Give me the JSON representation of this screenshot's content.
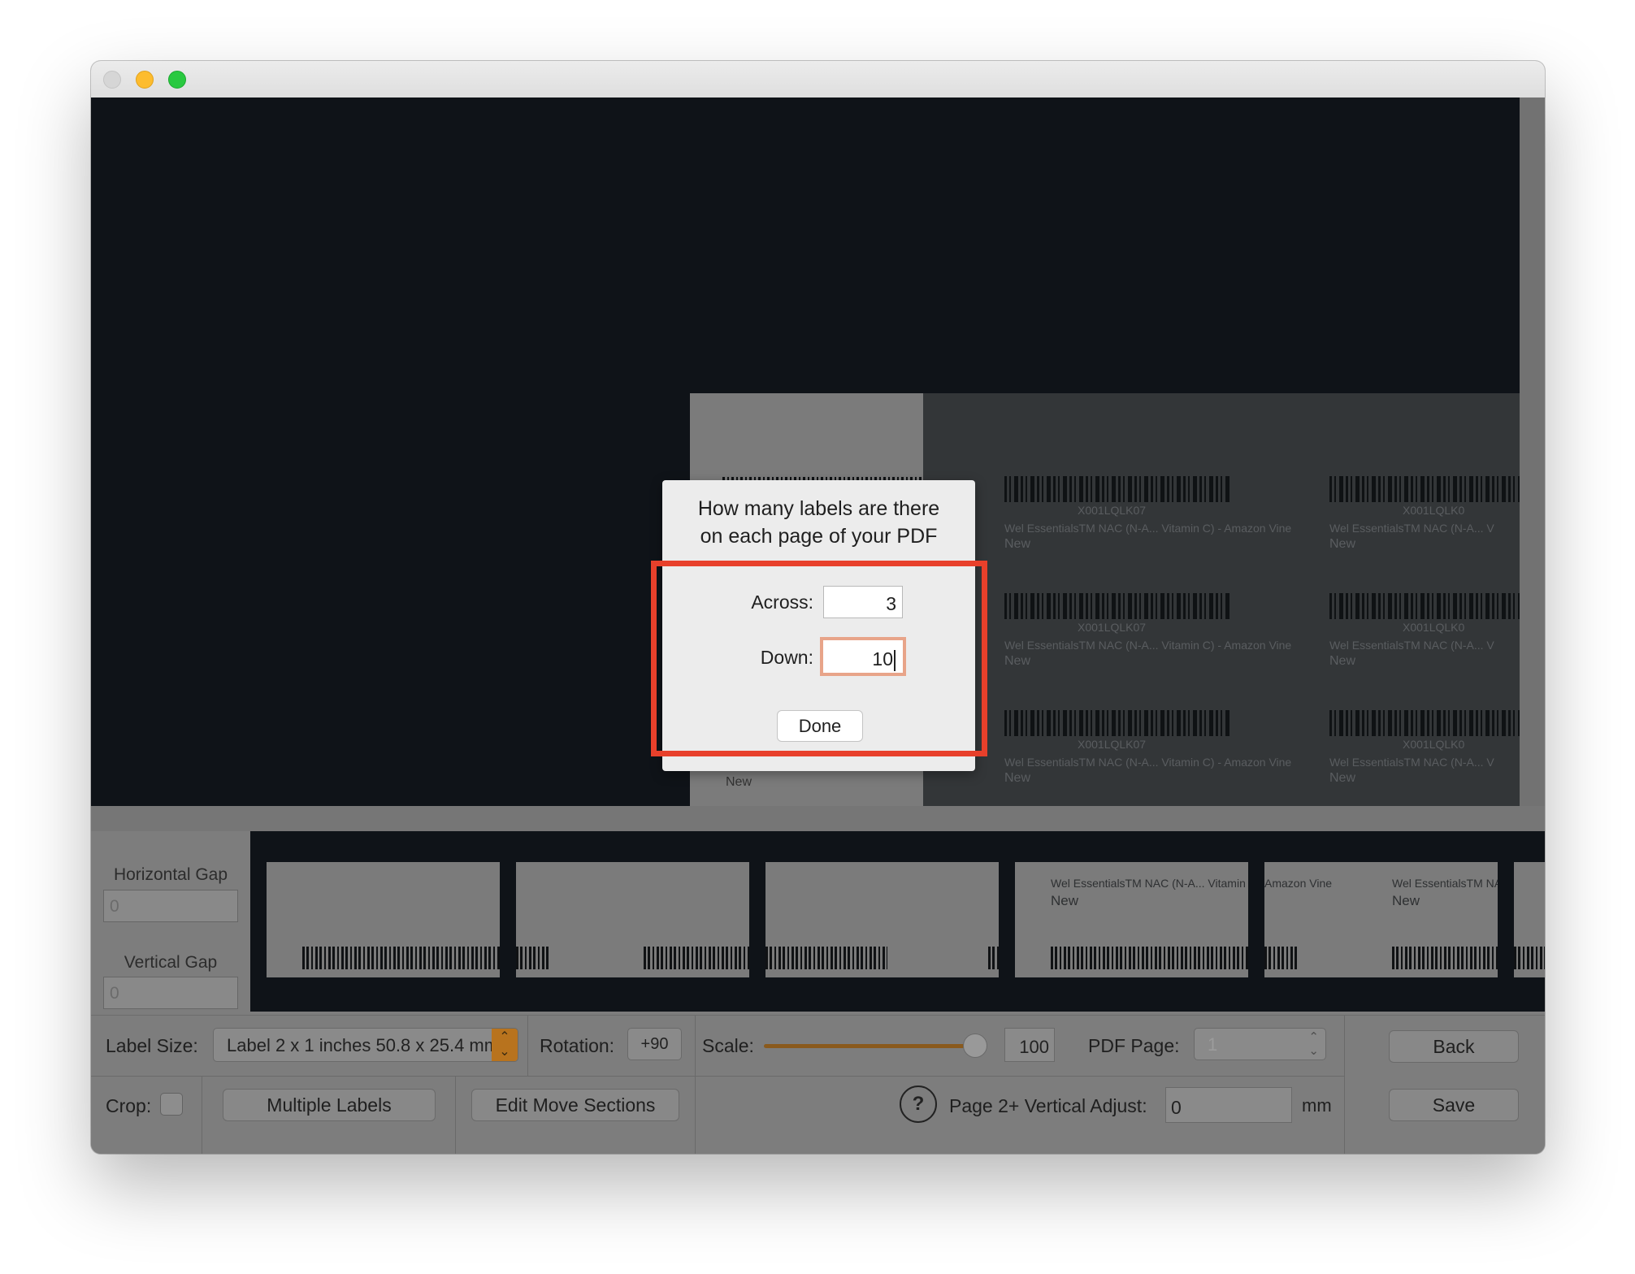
{
  "window": {
    "title": ""
  },
  "preview": {
    "labels": [
      {
        "code": "X001LQLK07",
        "desc": "Wel EssentialsTM NAC (N-A... Vitamin C) - Amazon Vine",
        "cond": "New"
      },
      {
        "code": "X001LQLK07",
        "desc": "Wel EssentialsTM NAC (N-A... Vitamin C) - Amazon Vine",
        "cond": "New"
      },
      {
        "code": "X001LQLK07",
        "desc": "Wel EssentialsTM NAC (N-A... Vitamin C) - Amazon Vine",
        "cond": "New"
      },
      {
        "code": "X001LQLK0",
        "desc": "Wel EssentialsTM NAC (N-A... V",
        "cond": "New"
      },
      {
        "code": "X001LQLK0",
        "desc": "Wel EssentialsTM NAC (N-A... V",
        "cond": "New"
      },
      {
        "code": "X001LQLK0",
        "desc": "Wel EssentialsTM NAC (N-A... V",
        "cond": "New"
      }
    ],
    "left_page_cond": "New"
  },
  "dialog": {
    "title_line1": "How many labels are there",
    "title_line2": "on each page of your PDF",
    "across_label": "Across:",
    "across_value": "3",
    "down_label": "Down:",
    "down_value": "10",
    "done_label": "Done"
  },
  "gaps": {
    "horizontal_label": "Horizontal Gap",
    "horizontal_placeholder": "0",
    "vertical_label": "Vertical Gap",
    "vertical_placeholder": "0"
  },
  "strip": {
    "thumb4_desc": "Wel EssentialsTM NAC (N-A... Vitamin C) - A",
    "thumb4_cond": "New",
    "thumb5_desc": "Amazon Vine",
    "thumb6_desc": "Wel EssentialsTM NAC (N-A...",
    "thumb6_cond": "New"
  },
  "toolbar": {
    "label_size_label": "Label Size:",
    "label_size_value": "Label 2 x 1 inches 50.8 x 25.4 mm",
    "rotation_label": "Rotation:",
    "rotation_value": "+90",
    "scale_label": "Scale:",
    "scale_value": "100",
    "scale_fraction": 1.0,
    "pdf_page_label": "PDF Page:",
    "pdf_page_value": "1",
    "back_label": "Back",
    "crop_label": "Crop:",
    "multiple_labels": "Multiple Labels",
    "edit_move_sections": "Edit Move Sections",
    "help_symbol": "?",
    "vertical_adjust_label": "Page 2+ Vertical Adjust:",
    "vertical_adjust_value": "0",
    "unit": "mm",
    "save_label": "Save"
  },
  "colors": {
    "accent_orange": "#e39a1c",
    "highlight_red": "#e8402b"
  }
}
